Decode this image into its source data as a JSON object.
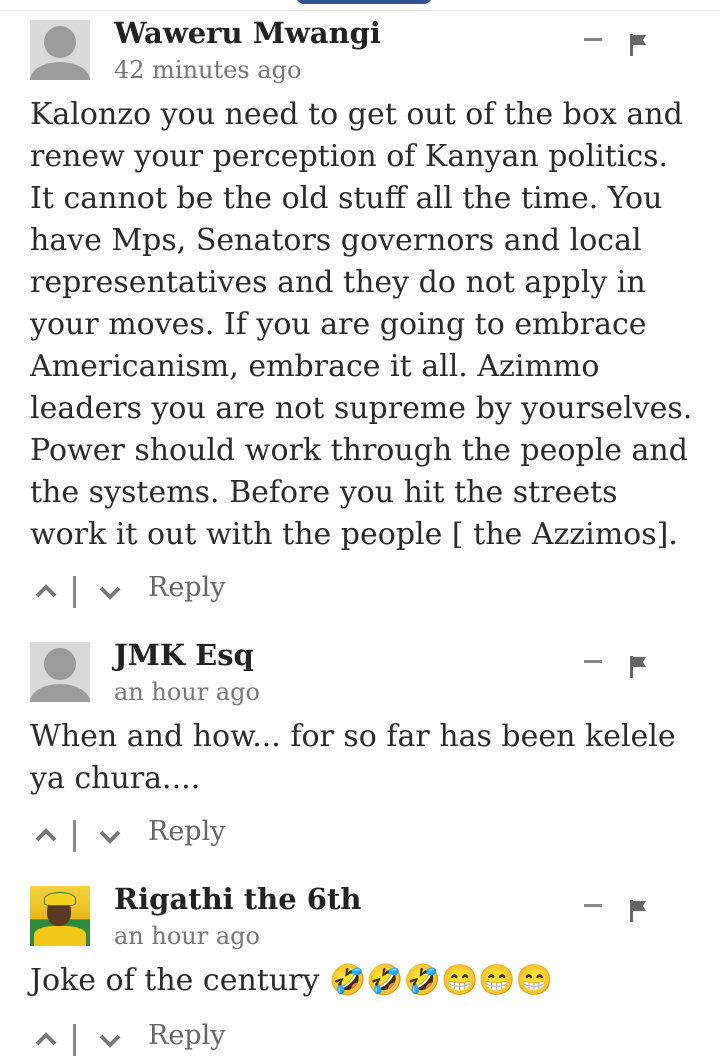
{
  "comments": [
    {
      "author": "Waweru Mwangi",
      "time": "42 minutes ago",
      "text": "Kalonzo you need to get out of the box and renew your perception of Kanyan politics. It cannot be the old stuff all the time. You have Mps, Senators governors and local representatives and they do not apply in your moves. If you are going to embrace Americanism, embrace it all. Azimmo leaders you are not supreme by yourselves. Power should work through the people and the systems. Before you hit the streets work it out with the people [ the Azzimos].",
      "reply_label": "Reply",
      "avatar": "default-avatar-icon"
    },
    {
      "author": "JMK Esq",
      "time": "an hour ago",
      "text": "When and how... for so far has been kelele ya chura....",
      "reply_label": "Reply",
      "avatar": "default-avatar-icon"
    },
    {
      "author": "Rigathi the 6th",
      "time": "an hour ago",
      "text": "Joke of the century 🤣🤣🤣😁😁😁",
      "reply_label": "Reply",
      "avatar": "user-photo-avatar"
    }
  ],
  "icons": {
    "minimize": "minimize-icon",
    "flag": "flag-icon",
    "upvote": "chevron-up-icon",
    "downvote": "chevron-down-icon"
  },
  "colors": {
    "author": "#222222",
    "meta": "#777777",
    "action": "#888888"
  }
}
